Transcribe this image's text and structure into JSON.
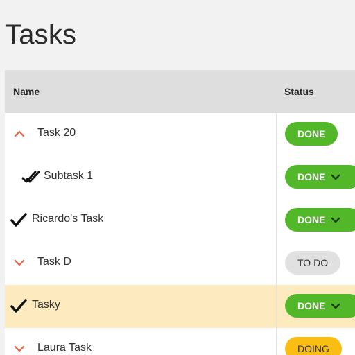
{
  "page": {
    "title": "Tasks"
  },
  "table": {
    "columns": {
      "name": "Name",
      "status": "Status"
    },
    "rows": [
      {
        "name": "Task 20",
        "icon": "chevron-up-icon",
        "status": "DONE",
        "status_dropdown": false,
        "indent": false,
        "highlighted": false
      },
      {
        "name": "Subtask 1",
        "icon": "double-check-icon",
        "status": "DONE",
        "status_dropdown": true,
        "indent": true,
        "highlighted": false
      },
      {
        "name": "Ricardo's Task",
        "icon": "check-icon",
        "status": "DONE",
        "status_dropdown": true,
        "indent": false,
        "highlighted": false
      },
      {
        "name": "Task D",
        "icon": "chevron-down-icon",
        "status": "TO DO",
        "status_dropdown": false,
        "indent": false,
        "highlighted": false
      },
      {
        "name": "Tasky",
        "icon": "check-icon",
        "status": "DONE",
        "status_dropdown": true,
        "indent": false,
        "highlighted": true
      },
      {
        "name": "Laura Task",
        "icon": "chevron-down-icon",
        "status": "DOING",
        "status_dropdown": false,
        "indent": false,
        "highlighted": false
      }
    ]
  },
  "colors": {
    "done": "#52b82a",
    "todo": "#e1e1e1",
    "doing": "#f9bd14",
    "chevron": "#e8643a",
    "highlight_row": "#fdebbf",
    "header_bg": "#dedede"
  }
}
